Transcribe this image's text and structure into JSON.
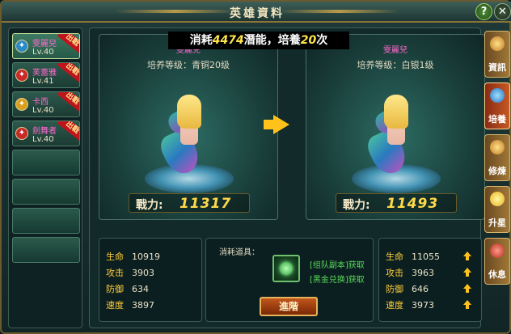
{
  "window": {
    "title": "英雄資料"
  },
  "heroes": [
    {
      "name": "雯麗兒",
      "level": "Lv.40",
      "badge": "出戰",
      "icon_color": "#2a8ac8"
    },
    {
      "name": "芙蕾雅",
      "level": "Lv.41",
      "badge": "出戰",
      "icon_color": "#c82a2a"
    },
    {
      "name": "卡西",
      "level": "Lv.40",
      "badge": "出戰",
      "icon_color": "#d8a020"
    },
    {
      "name": "劍舞者",
      "level": "Lv.40",
      "badge": "出戰",
      "icon_color": "#c82a2a"
    }
  ],
  "cost": {
    "prefix": "消耗",
    "amount": "4474",
    "middle": "潛能，培養",
    "times": "20",
    "suffix": "次"
  },
  "current": {
    "name": "雯麗兒",
    "grade_label": "培养等级：",
    "grade": "青铜20级",
    "power_label": "戰力:",
    "power": "11317",
    "stats": [
      {
        "label": "生命",
        "value": "10919"
      },
      {
        "label": "攻击",
        "value": "3903"
      },
      {
        "label": "防御",
        "value": "634"
      },
      {
        "label": "速度",
        "value": "3897"
      }
    ]
  },
  "next": {
    "name": "雯麗兒",
    "grade_label": "培养等级：",
    "grade": "白银1级",
    "power_label": "戰力:",
    "power": "11493",
    "stats": [
      {
        "label": "生命",
        "value": "11055"
      },
      {
        "label": "攻击",
        "value": "3963"
      },
      {
        "label": "防御",
        "value": "646"
      },
      {
        "label": "速度",
        "value": "3973"
      }
    ]
  },
  "consume": {
    "label": "消耗道具：",
    "link1": "[组队副本]获取",
    "link2": "[黑金兑换]获取",
    "button": "進階"
  },
  "tabs": [
    {
      "label": "資訊",
      "icon": "book-icon"
    },
    {
      "label": "培養",
      "icon": "potion-icon"
    },
    {
      "label": "修煉",
      "icon": "scroll-icon"
    },
    {
      "label": "升星",
      "icon": "star-icon"
    },
    {
      "label": "休息",
      "icon": "chest-icon"
    }
  ],
  "help_glyph": "?",
  "close_glyph": "✕"
}
